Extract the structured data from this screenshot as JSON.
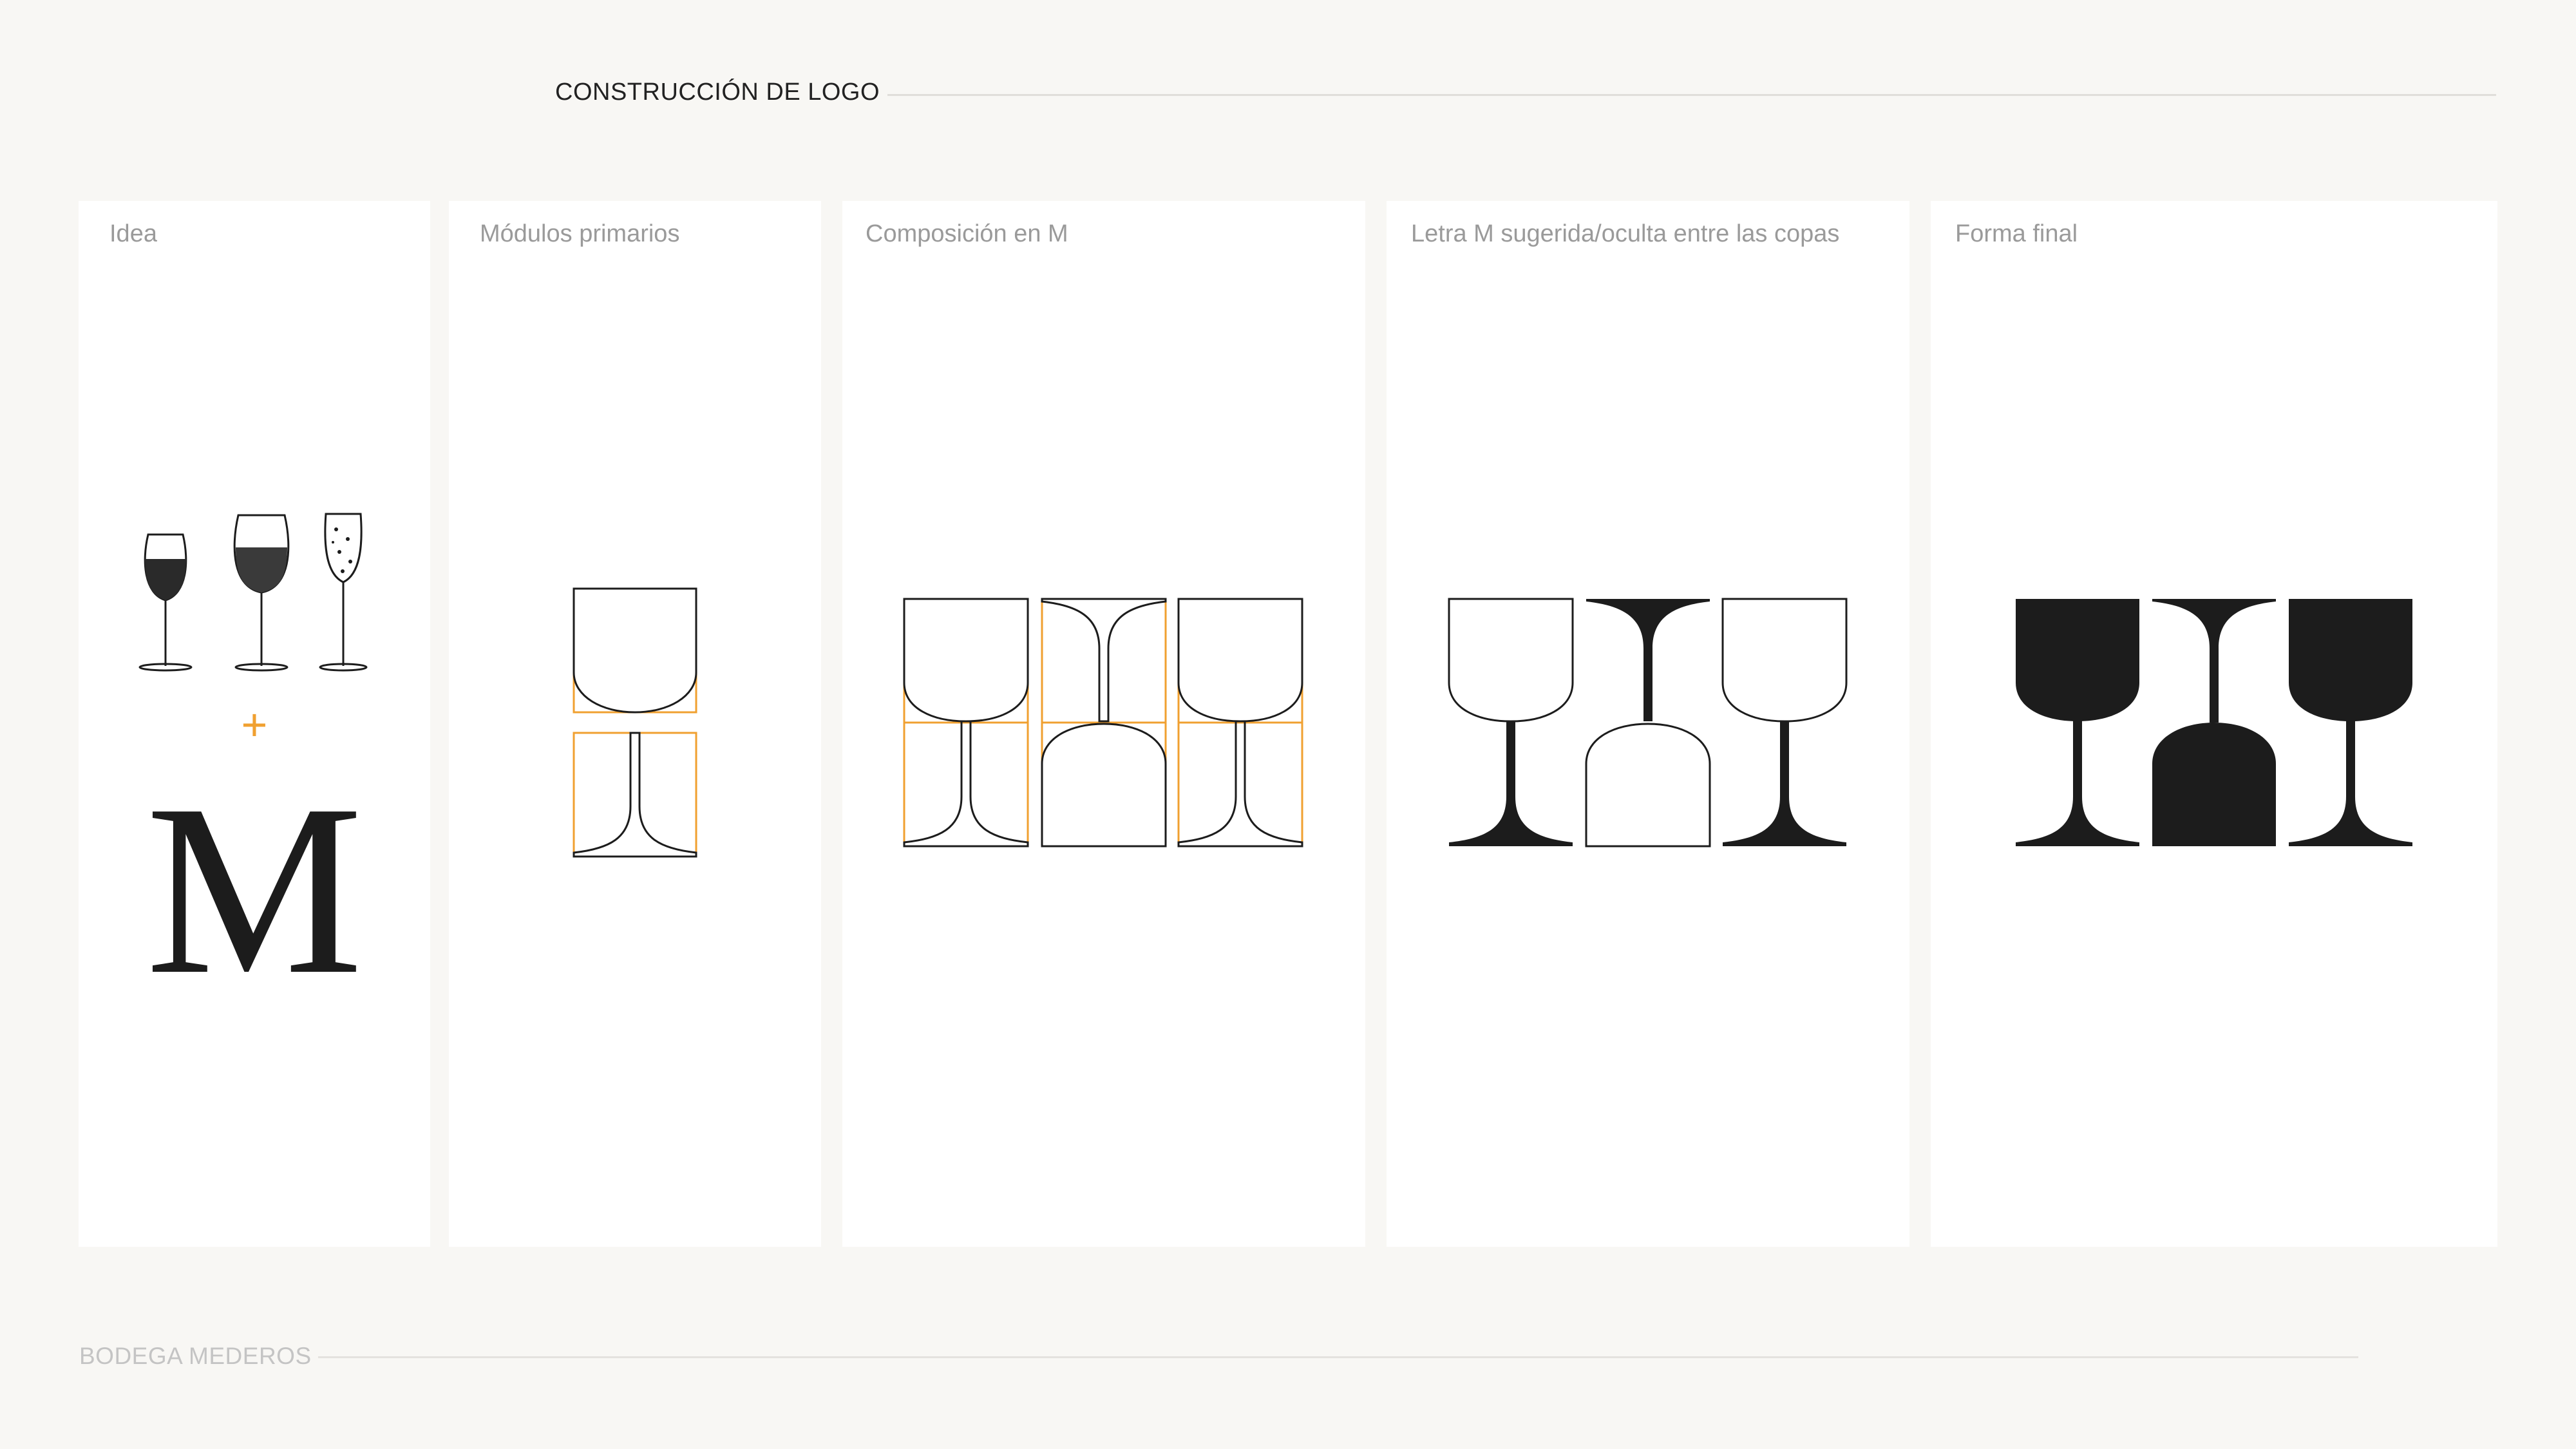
{
  "header": {
    "title": "CONSTRUCCIÓN DE LOGO"
  },
  "panels": [
    {
      "label": "Idea",
      "plus": "+",
      "letter": "M"
    },
    {
      "label": "Módulos primarios"
    },
    {
      "label": "Composición en M"
    },
    {
      "label": "Letra M sugerida/oculta entre las copas"
    },
    {
      "label": "Forma final"
    }
  ],
  "footer": {
    "brand": "BODEGA MEDEROS"
  },
  "colors": {
    "ink": "#1c1c1c",
    "guide": "#f0a030",
    "background": "#f8f7f4",
    "panel": "#ffffff"
  }
}
